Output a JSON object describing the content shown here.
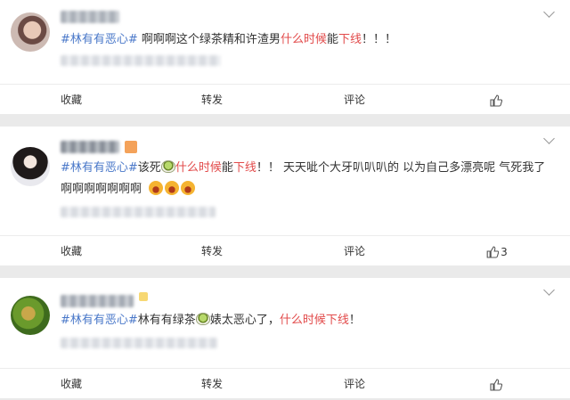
{
  "comments": [
    {
      "topic": "#林有有恶心#",
      "text_before": " 啊啊啊这个绿茶精和许渣男",
      "red_a": "什么时候",
      "mid": "能",
      "red_b": "下线",
      "text_after": "！！！",
      "actions": {
        "collect": "收藏",
        "repost": "转发",
        "comment": "评论",
        "like_count": ""
      }
    },
    {
      "topic": "#林有有恶心#",
      "text_before": "该死",
      "red_a": "什么时候",
      "mid": "能",
      "red_b": "下线",
      "text_after": "！！ 天天呲个大牙叭叭叭的 以为自己多漂亮呢 气死我了",
      "line2": "啊啊啊啊啊啊啊",
      "actions": {
        "collect": "收藏",
        "repost": "转发",
        "comment": "评论",
        "like_count": "3"
      }
    },
    {
      "topic": "#林有有恶心#",
      "text_before": "林有有绿茶",
      "text_mid": "婊太恶心了，",
      "red_a": "什么时候下线",
      "text_after": "！",
      "actions": {
        "collect": "收藏",
        "repost": "转发",
        "comment": "评论",
        "like_count": ""
      }
    }
  ],
  "icons": {
    "dropdown": "chevron-down-icon",
    "like": "thumbs-up-icon",
    "avatar": "avatar",
    "emoji": "laughing-face-emoji",
    "tea": "green-tea-emoji"
  },
  "colors": {
    "topic": "#4a78c9",
    "highlight": "#e24b4b",
    "background": "#eaeaea"
  }
}
